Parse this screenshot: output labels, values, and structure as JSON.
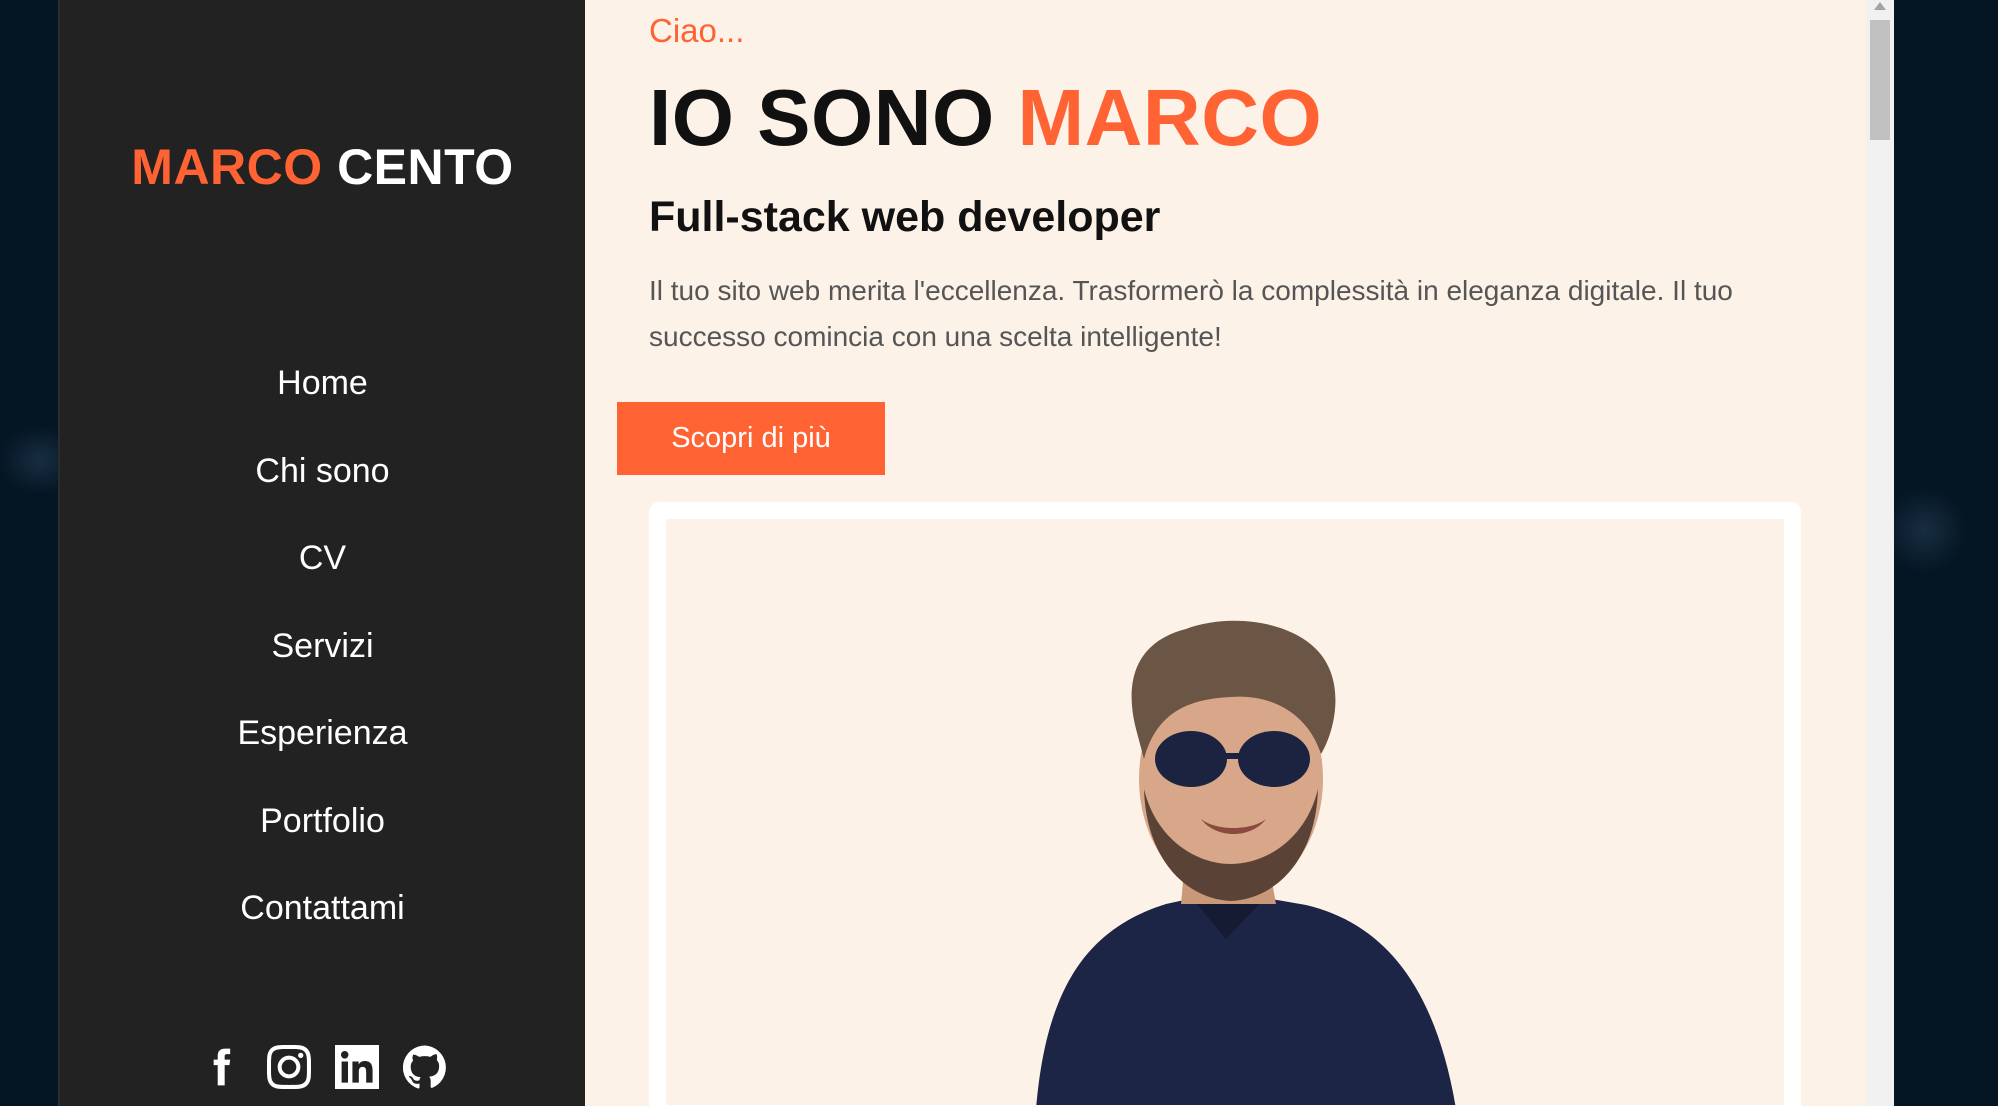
{
  "brand": {
    "first": "MARCO",
    "last": "CENTO"
  },
  "nav": [
    {
      "label": "Home"
    },
    {
      "label": "Chi sono"
    },
    {
      "label": "CV"
    },
    {
      "label": "Servizi"
    },
    {
      "label": "Esperienza"
    },
    {
      "label": "Portfolio"
    },
    {
      "label": "Contattami"
    }
  ],
  "social": [
    "facebook-icon",
    "instagram-icon",
    "linkedin-icon",
    "github-icon"
  ],
  "hero": {
    "greeting": "Ciao...",
    "headline_prefix": "IO SONO",
    "headline_name": "MARCO",
    "role": "Full-stack web developer",
    "description": "Il tuo sito web merita l'eccellenza. Trasformerò la complessità in eleganza digitale. Il tuo successo comincia con una scelta intelligente!",
    "cta_label": "Scopri di più"
  },
  "colors": {
    "accent": "#ff6233",
    "sidebar_bg": "#222222",
    "content_bg": "#fdf2e8"
  }
}
